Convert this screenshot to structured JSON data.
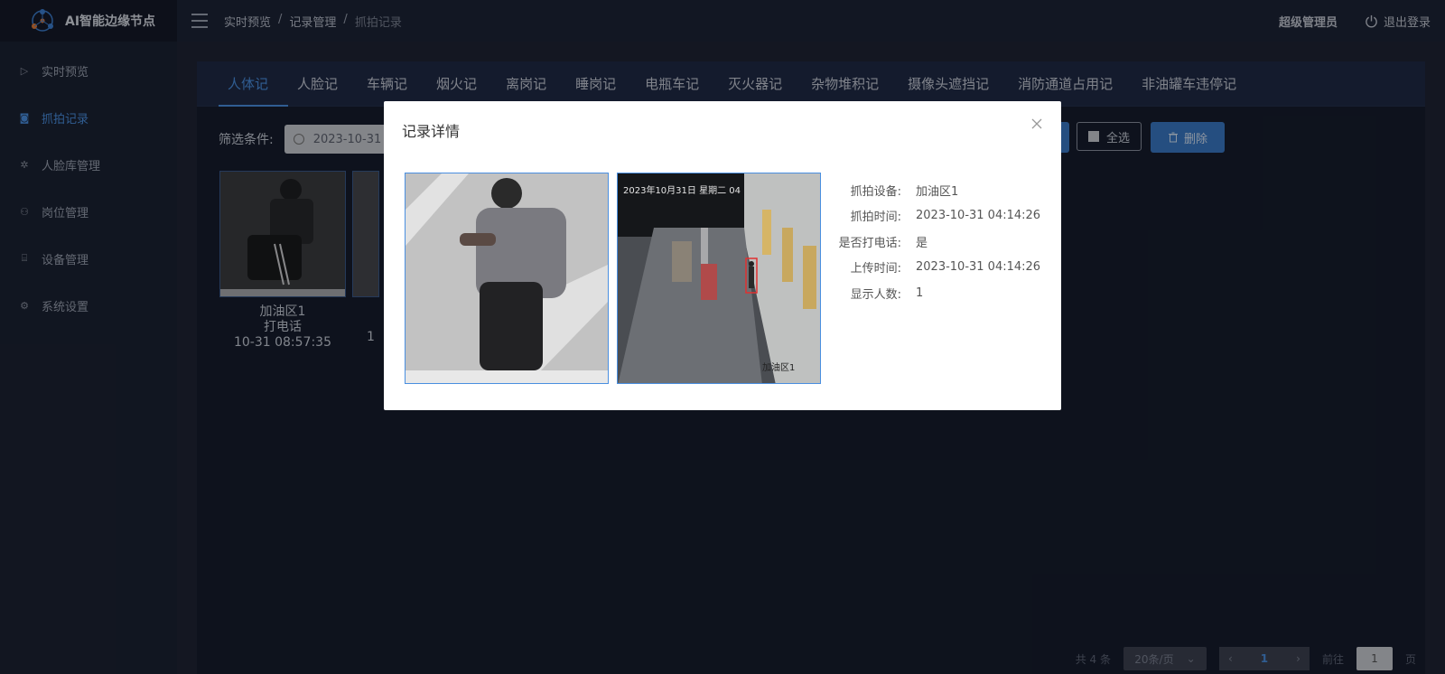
{
  "app": {
    "title": "AI智能边缘节点"
  },
  "sidebar": {
    "items": [
      {
        "label": "实时预览",
        "icon": "play-icon",
        "active": false
      },
      {
        "label": "抓拍记录",
        "icon": "camera-icon",
        "active": true
      },
      {
        "label": "人脸库管理",
        "icon": "gear-icon",
        "active": false
      },
      {
        "label": "岗位管理",
        "icon": "org-icon",
        "active": false
      },
      {
        "label": "设备管理",
        "icon": "device-icon",
        "active": false
      },
      {
        "label": "系统设置",
        "icon": "settings-icon",
        "active": false
      }
    ]
  },
  "header": {
    "breadcrumb": [
      "实时预览",
      "记录管理",
      "抓拍记录"
    ],
    "breadcrumb_sep": "/",
    "user": "超级管理员",
    "logout": "退出登录"
  },
  "tabs": [
    "人体记",
    "人脸记",
    "车辆记",
    "烟火记",
    "离岗记",
    "睡岗记",
    "电瓶车记",
    "灭火器记",
    "杂物堆积记",
    "摄像头遮挡记",
    "消防通道占用记",
    "非油罐车违停记"
  ],
  "filter": {
    "label": "筛选条件:",
    "date_value": "2023-10-31",
    "select_all": "全选",
    "delete": "删除"
  },
  "records": [
    {
      "device": "加油区1",
      "event": "打电话",
      "time": "10-31 08:57:35"
    },
    {
      "device": "",
      "event": "",
      "time": "1"
    }
  ],
  "pagination": {
    "total": "共 4 条",
    "page_size": "20条/页",
    "current": "1",
    "goto_label": "前往",
    "goto_value": "1",
    "page_suffix": "页"
  },
  "modal": {
    "title": "记录详情",
    "overlay_stamp": "2023年10月31日 星期二 04",
    "overlay_location": "加油区1",
    "fields": [
      {
        "label": "抓拍设备:",
        "value": "加油区1"
      },
      {
        "label": "抓拍时间:",
        "value": "2023-10-31 04:14:26"
      },
      {
        "label": "是否打电话:",
        "value": "是"
      },
      {
        "label": "上传时间:",
        "value": "2023-10-31 04:14:26"
      },
      {
        "label": "显示人数:",
        "value": "1"
      }
    ]
  },
  "colors": {
    "accent": "#4a8fe0",
    "sidebar": "#1b2233",
    "content_bg": "#161d2d"
  }
}
